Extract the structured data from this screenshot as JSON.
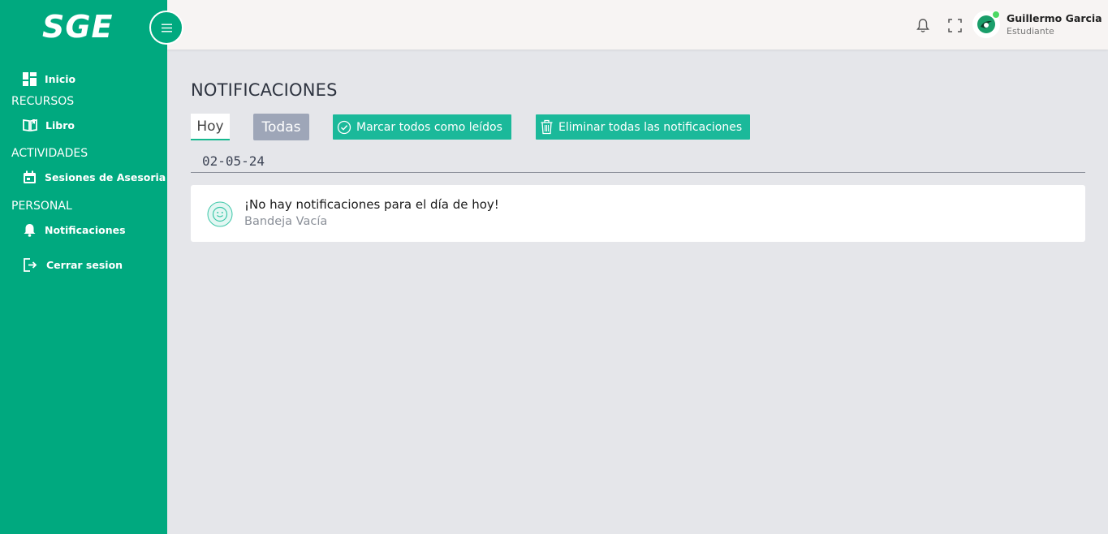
{
  "app": {
    "logo": "SGE"
  },
  "sidebar": {
    "items": [
      {
        "label": "Inicio",
        "icon": "dashboard-icon"
      },
      {
        "label": "Libro",
        "icon": "book-icon"
      },
      {
        "label": "Sesiones de Asesoria",
        "icon": "calendar-icon"
      },
      {
        "label": "Notificaciones",
        "icon": "bell-icon"
      },
      {
        "label": "Cerrar sesion",
        "icon": "logout-icon"
      }
    ],
    "sections": [
      "RECURSOS",
      "ACTIVIDADES",
      "PERSONAL"
    ]
  },
  "user": {
    "name": "Guillermo Garcia",
    "role": "Estudiante",
    "status_color": "#4cd964"
  },
  "page": {
    "title": "NOTIFICACIONES",
    "tabs": [
      "Hoy",
      "Todas"
    ],
    "actions": {
      "mark_read": "Marcar todos como leídos",
      "delete_all": "Eliminar todas las notificaciones"
    },
    "date": "02-05-24",
    "notification": {
      "title": "¡No hay notificaciones para el día de hoy!",
      "subtitle": "Bandeja Vacía"
    }
  },
  "colors": {
    "sidebar": "#00a97f",
    "accent": "#1bb99a",
    "tab_inactive": "#9ea6b8"
  }
}
